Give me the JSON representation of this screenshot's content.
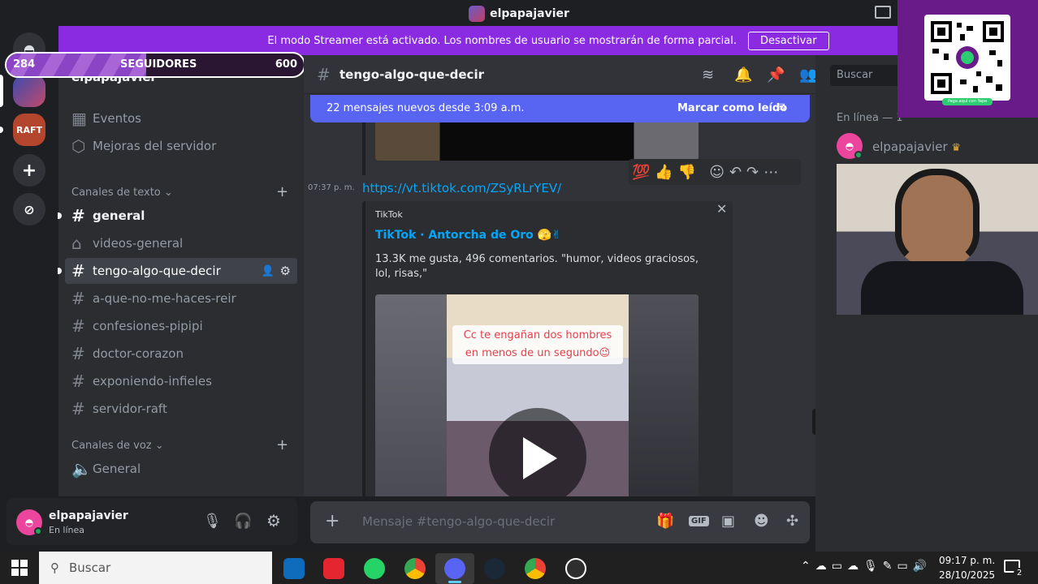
{
  "window": {
    "title": "elpapajavier"
  },
  "banner": {
    "text": "El modo Streamer está activado. Los nombres de usuario se mostrarán de forma parcial.",
    "button": "Desactivar"
  },
  "followers": {
    "current": "284",
    "label": "SEGUIDORES",
    "goal": "600",
    "progress": 0.47
  },
  "servers": [
    {
      "name": "discord-home-icon"
    },
    {
      "name": "server-icon-1"
    },
    {
      "name": "raft-server",
      "label": "RAFT"
    },
    {
      "name": "add-server-icon"
    },
    {
      "name": "discover-icon"
    }
  ],
  "sidebar": {
    "server_name": "elpapajavier",
    "items": [
      {
        "label": "Eventos",
        "icon": "calendar-icon"
      },
      {
        "label": "Mejoras del servidor",
        "icon": "boost-icon"
      }
    ],
    "text_category": "Canales de texto",
    "text_channels": [
      {
        "label": "general",
        "state": "unread"
      },
      {
        "label": "videos-general",
        "state": "forum"
      },
      {
        "label": "tengo-algo-que-decir",
        "state": "active"
      },
      {
        "label": "a-que-no-me-haces-reir",
        "state": "normal"
      },
      {
        "label": "confesiones-pipipi",
        "state": "normal"
      },
      {
        "label": "doctor-corazon",
        "state": "normal"
      },
      {
        "label": "exponiendo-infieles",
        "state": "normal"
      },
      {
        "label": "servidor-raft",
        "state": "normal"
      }
    ],
    "voice_category": "Canales de voz",
    "voice_channels": [
      {
        "label": "General"
      }
    ]
  },
  "user_panel": {
    "name": "elpapajavier",
    "status": "En línea"
  },
  "chat_header": {
    "channel": "tengo-algo-que-decir",
    "search_placeholder": "Buscar"
  },
  "new_messages": {
    "text": "22 mensajes nuevos desde 3:09 a.m.",
    "action": "Marcar como leído"
  },
  "message": {
    "time": "07:37 p. m.",
    "link": "https://vt.tiktok.com/ZSyRLrYEV/",
    "embed": {
      "provider": "TikTok",
      "title": "TikTok · Antorcha de Oro 🫣✌",
      "description": "13.3K me gusta, 496 comentarios. \"humor, videos graciosos, lol, risas,\"",
      "video_caption": "Cc te engañan dos hombres en menos de un segundo😉"
    },
    "reactions": [
      "💯",
      "👍",
      "👎"
    ]
  },
  "composer": {
    "placeholder": "Mensaje #tengo-algo-que-decir"
  },
  "members": {
    "header": "En línea — 1",
    "list": [
      {
        "name": "elpapajavier",
        "badge": "♛"
      }
    ]
  },
  "qr_label": "Paga aquí con Yape",
  "taskbar": {
    "search": "Buscar",
    "time": "09:17 p. m.",
    "date": "28/10/2025",
    "notifications": "2"
  },
  "colors": {
    "blurple": "#5865f2",
    "streamer_banner": "#8a2be2",
    "link": "#00a8fc",
    "online": "#23a55a"
  }
}
